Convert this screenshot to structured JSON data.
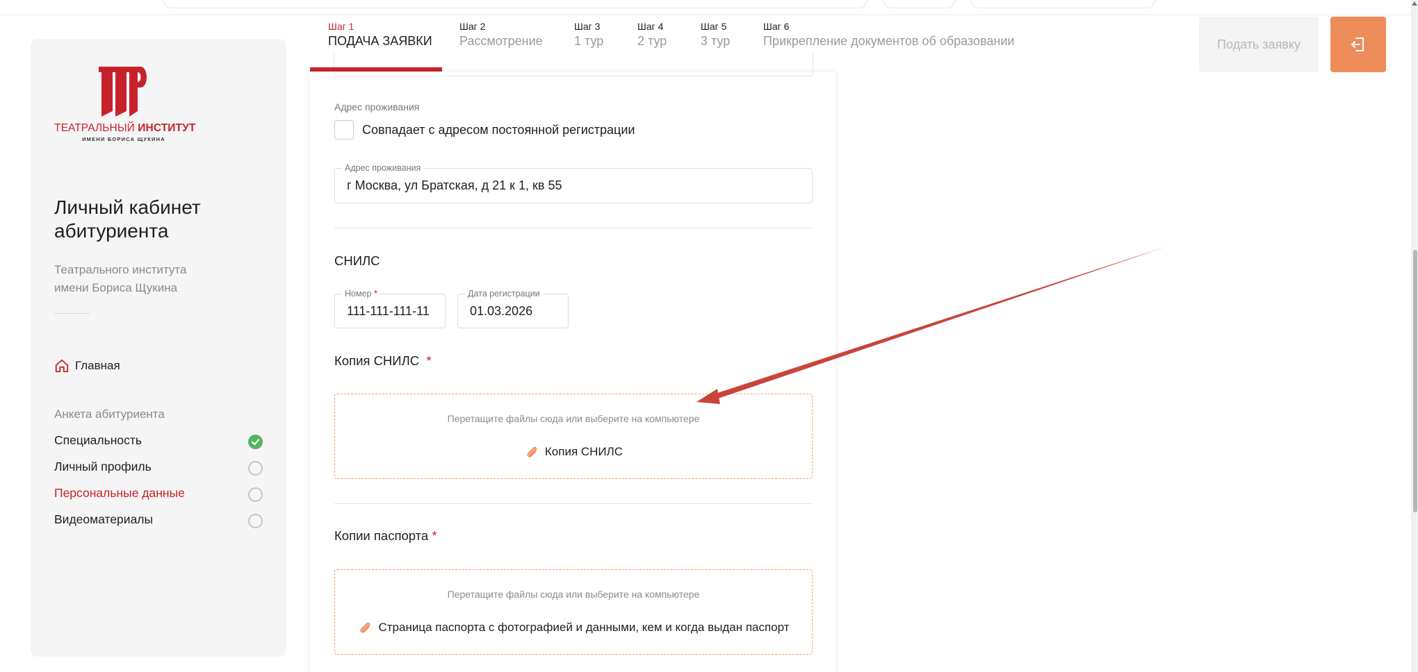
{
  "sidebar": {
    "logo": {
      "line1_a": "ТЕАТРАЛЬНЫЙ ",
      "line1_b": "ИНСТИТУТ",
      "line2": "ИМЕНИ БОРИСА ЩУКИНА",
      "accent": "#c7222c"
    },
    "title_line1": "Личный кабинет",
    "title_line2": "абитуриента",
    "subtitle_line1": "Театрального института",
    "subtitle_line2": "имени Бориса Щукина",
    "home_label": "Главная",
    "anketa_heading": "Анкета абитуриента",
    "anketa_items": [
      {
        "label": "Специальность",
        "status": "done"
      },
      {
        "label": "Личный профиль",
        "status": "empty"
      },
      {
        "label": "Персональные данные",
        "status": "empty",
        "active": true
      },
      {
        "label": "Видеоматериалы",
        "status": "empty"
      }
    ]
  },
  "steps": [
    {
      "num": "Шаг 1",
      "name": "ПОДАЧА ЗАЯВКИ",
      "active": true
    },
    {
      "num": "Шаг 2",
      "name": "Рассмотрение"
    },
    {
      "num": "Шаг 3",
      "name": "1 тур"
    },
    {
      "num": "Шаг 4",
      "name": "2 тур"
    },
    {
      "num": "Шаг 5",
      "name": "3 тур"
    },
    {
      "num": "Шаг 6",
      "name": "Прикрепление документов об образовании"
    }
  ],
  "header": {
    "submit_label": "Подать заявку",
    "exit_icon": "logout-icon",
    "exit_color": "#ee8c59"
  },
  "form": {
    "residence_heading": "Адрес проживания",
    "same_address_label": "Совпадает с адресом постоянной регистрации",
    "residence_field": {
      "legend": "Адрес проживания",
      "value": "г Москва, ул Братская, д 21 к 1, кв 55"
    },
    "snils_heading": "СНИЛС",
    "snils_number": {
      "legend": "Номер",
      "required_mark": "*",
      "value": "111-111-111-11"
    },
    "snils_date": {
      "legend": "Дата регистрации",
      "value": "01.03.2026"
    },
    "snils_copy": {
      "title": "Копия СНИЛС",
      "required_mark": "*",
      "hint": "Перетащите файлы сюда или выберите на компьютере",
      "file_label": "Копия СНИЛС"
    },
    "passport_copy": {
      "title": "Копии паспорта",
      "required_mark": "*",
      "hint": "Перетащите файлы сюда или выберите на компьютере",
      "file_label": "Страница паспорта с фотографией и данными, кем и когда выдан паспорт"
    }
  }
}
